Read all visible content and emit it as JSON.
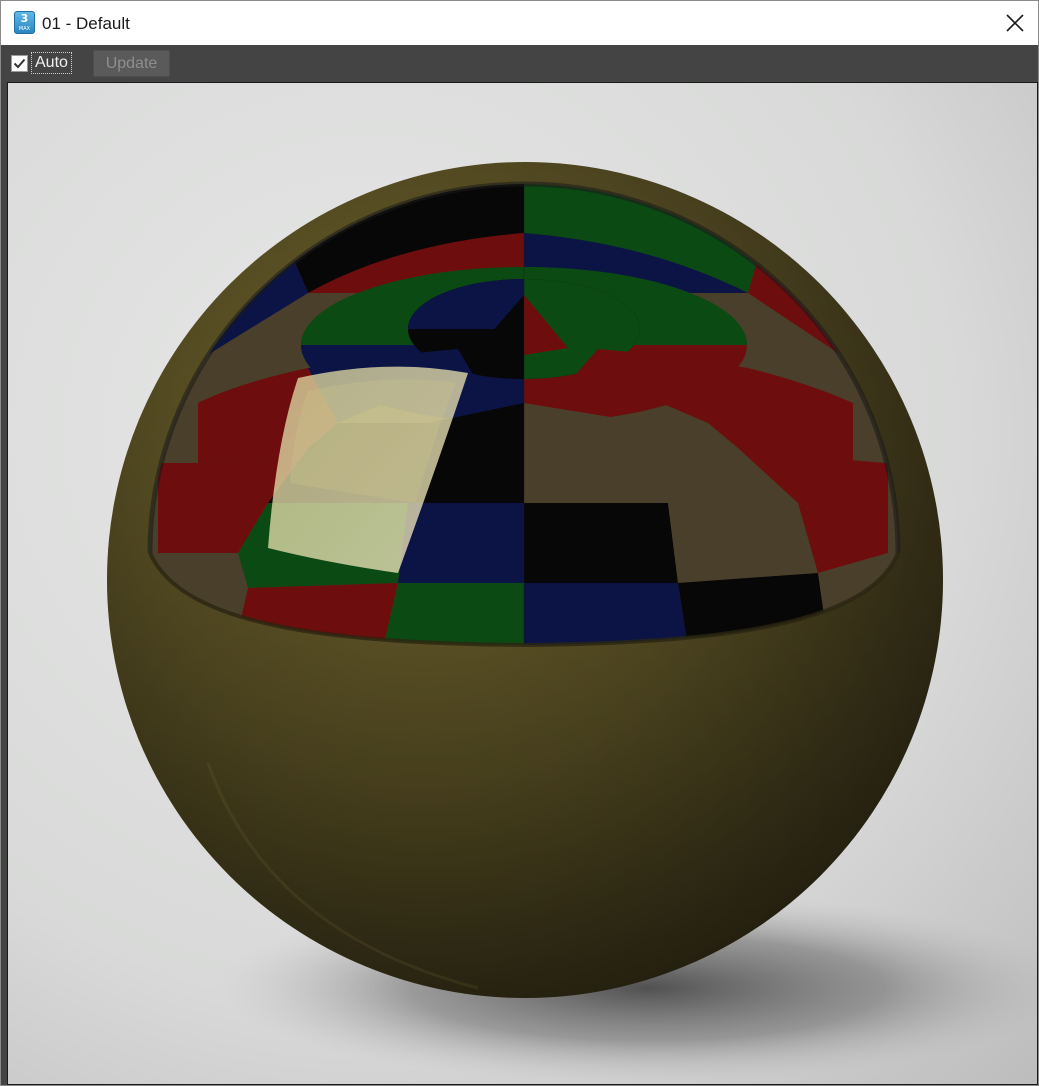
{
  "window": {
    "title": "01 - Default",
    "app_icon": {
      "name": "3ds-max-icon",
      "number": "3",
      "sub": "MAX"
    }
  },
  "toolbar": {
    "auto_checkbox": {
      "checked": true,
      "label": "Auto"
    },
    "update_button": {
      "label": "Update",
      "enabled": false
    }
  },
  "viewport": {
    "content": "material-preview-render",
    "colors": {
      "frame": "#444444",
      "sphere_base": "#6b5f2a",
      "reflection_red": "#6e0d0d",
      "reflection_green": "#0c4a14",
      "reflection_blue": "#0c1446",
      "reflection_black": "#070707",
      "reflection_brown": "#4a3f2a",
      "highlight": "#e2d9a8"
    }
  }
}
